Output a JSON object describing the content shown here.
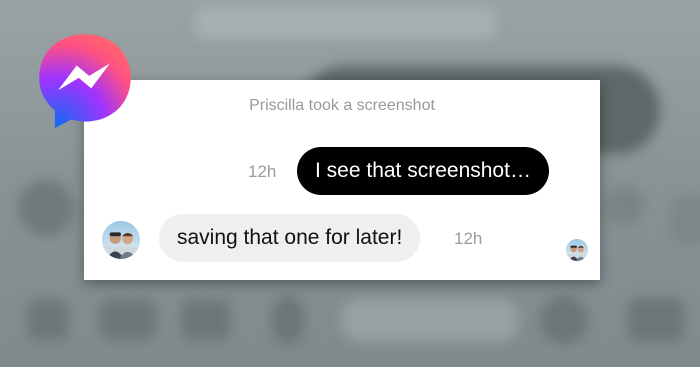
{
  "notice": "Priscilla took a screenshot",
  "messages": [
    {
      "direction": "sent",
      "text": "I see that screenshot…",
      "time": "12h"
    },
    {
      "direction": "received",
      "text": "saving that one for later!",
      "time": "12h"
    }
  ],
  "icons": {
    "logo": "messenger-logo-icon",
    "avatar": "profile-photo-icon",
    "read_receipt": "read-receipt-avatar-icon"
  },
  "colors": {
    "sent_bubble": "#000000",
    "sent_text": "#ffffff",
    "received_bubble": "#efefef",
    "received_text": "#111111",
    "timestamp": "#9b9b9b",
    "notice_text": "#9a9a9a",
    "logo_gradient_start": "#1877f2",
    "logo_gradient_mid": "#a334fa",
    "logo_gradient_end": "#ff6968"
  }
}
